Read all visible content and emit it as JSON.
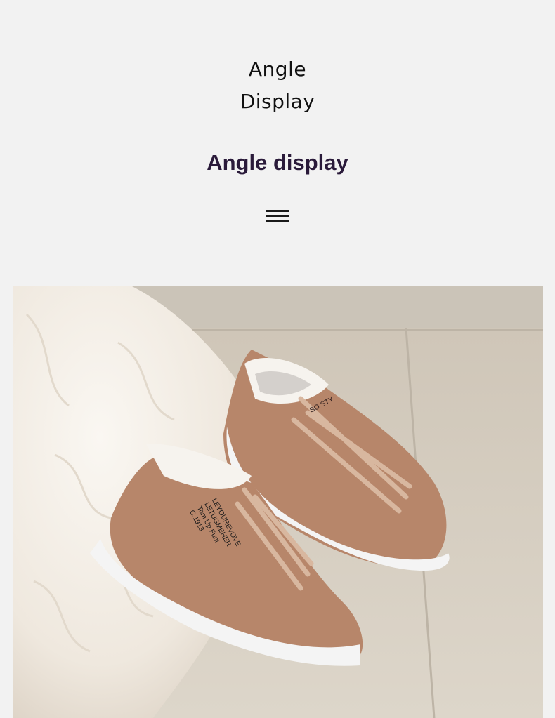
{
  "header": {
    "title_line1": "Angle",
    "title_line2": "Display",
    "subtitle": "Angle display"
  },
  "icons": {
    "menu": "hamburger-menu-icon"
  },
  "product_photo": {
    "shoe_print": [
      "LEYOUREVOVE",
      "LETUGMEHER",
      "Tom Up Funl",
      "C.1913"
    ],
    "tongue_print": "SO STY"
  },
  "colors": {
    "background": "#f2f2f2",
    "title": "#111111",
    "subtitle": "#2a1a3a",
    "shoe_leather": "#b7866a",
    "sole": "#f5f5f5",
    "floor": "#d8d0c3",
    "fur": "#efe9e1"
  }
}
